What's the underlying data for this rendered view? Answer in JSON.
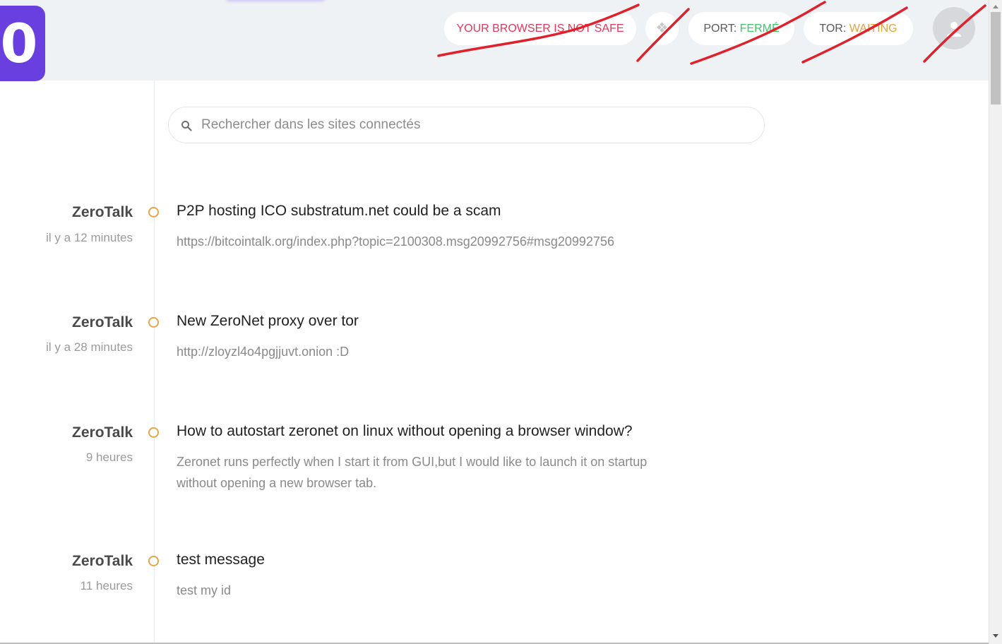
{
  "header": {
    "logo_text": "0",
    "badges": {
      "browser_warning": "YOUR BROWSER IS NOT SAFE",
      "port_label": "PORT:",
      "port_value": "FERMÉ",
      "tor_label": "TOR:",
      "tor_value": "WAITING"
    },
    "diamond_icon": "diamond-icon",
    "user_icon": "user-icon",
    "colors": {
      "brand": "#6a3fe0",
      "warning": "#e8335a",
      "status_ok": "#3cc76a",
      "status_waiting": "#e0a440",
      "scribble": "#e0202a"
    }
  },
  "search": {
    "placeholder": "Rechercher dans les sites connectés",
    "value": "",
    "icon": "search-icon"
  },
  "feed": {
    "items": [
      {
        "site": "ZeroTalk",
        "time": "il y a 12 minutes",
        "title": "P2P hosting ICO substratum.net could be a scam",
        "body": "https://bitcointalk.org/index.php?topic=2100308.msg20992756#msg20992756"
      },
      {
        "site": "ZeroTalk",
        "time": "il y a 28 minutes",
        "title": "New ZeroNet proxy over tor",
        "body": "http://zloyzl4o4pgjjuvt.onion :D"
      },
      {
        "site": "ZeroTalk",
        "time": "9 heures",
        "title": "How to autostart zeronet on linux without opening a browser window?",
        "body": "Zeronet runs perfectly when I start it from GUI,but I would like to launch it on startup without opening a new browser tab."
      },
      {
        "site": "ZeroTalk",
        "time": "11 heures",
        "title": "test message",
        "body": "test my id"
      }
    ]
  }
}
